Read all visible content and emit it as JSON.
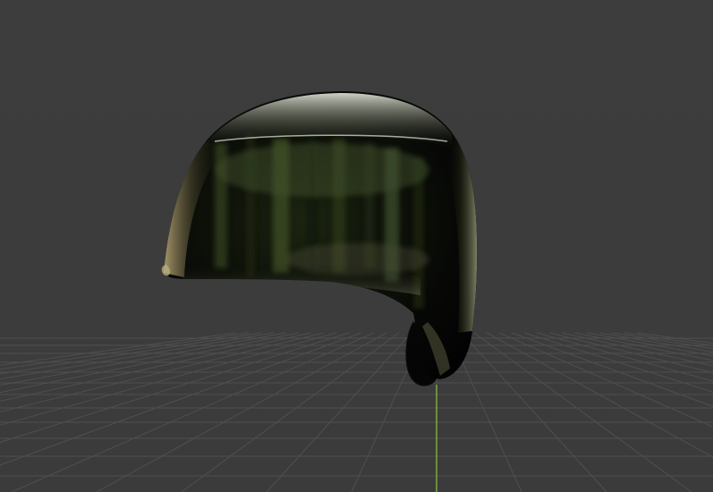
{
  "viewport": {
    "background_color": "#3d3d3d",
    "grid_line_color": "#4f4f4f",
    "y_axis_color": "#8ec63f",
    "grid_floor": true,
    "axis_line": "y",
    "view": "perspective"
  },
  "scene": {
    "object": "batting-helmet",
    "material": "glossy-reflective-dark",
    "reflection_tint": "#3a4a2a"
  }
}
